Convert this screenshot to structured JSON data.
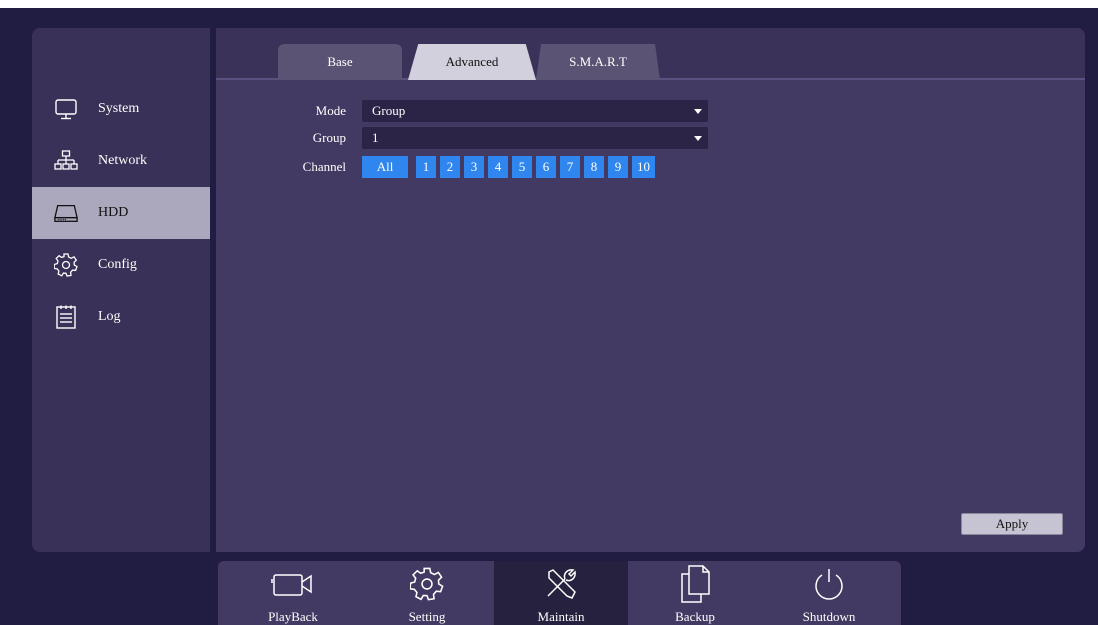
{
  "banner": {
    "text": ""
  },
  "sidebar": {
    "items": [
      {
        "label": "System",
        "icon": "monitor-icon"
      },
      {
        "label": "Network",
        "icon": "network-icon"
      },
      {
        "label": "HDD",
        "icon": "hdd-icon",
        "active": true
      },
      {
        "label": "Config",
        "icon": "gear-icon"
      },
      {
        "label": "Log",
        "icon": "log-icon"
      }
    ]
  },
  "tabs": [
    {
      "label": "Base"
    },
    {
      "label": "Advanced",
      "active": true
    },
    {
      "label": "S.M.A.R.T"
    }
  ],
  "form": {
    "mode_label": "Mode",
    "mode_value": "Group",
    "group_label": "Group",
    "group_value": "1",
    "channel_label": "Channel",
    "channels": [
      "All",
      "1",
      "2",
      "3",
      "4",
      "5",
      "6",
      "7",
      "8",
      "9",
      "10"
    ]
  },
  "apply_label": "Apply",
  "toolbar": {
    "items": [
      {
        "label": "PlayBack",
        "icon": "camera-icon"
      },
      {
        "label": "Setting",
        "icon": "gear-icon"
      },
      {
        "label": "Maintain",
        "icon": "tools-icon",
        "active": true
      },
      {
        "label": "Backup",
        "icon": "copy-icon"
      },
      {
        "label": "Shutdown",
        "icon": "power-icon"
      }
    ]
  },
  "colors": {
    "background": "#211c42",
    "panel": "#433a63",
    "accent": "#2f86ee",
    "active_sidebar": "#aba8bd"
  }
}
